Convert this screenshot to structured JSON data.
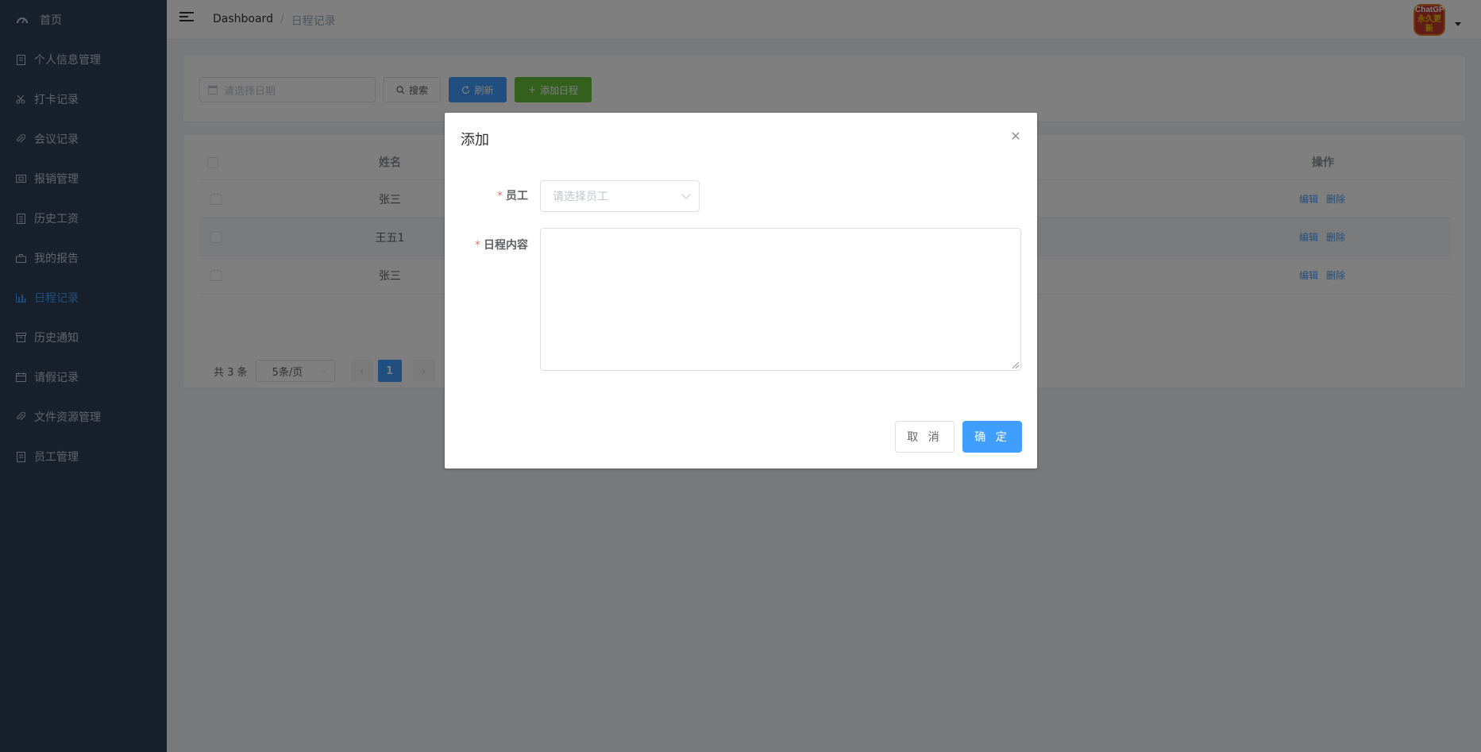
{
  "sidebar": {
    "items": [
      {
        "label": "首页",
        "icon": "dashboard-icon",
        "active": false
      },
      {
        "label": "个人信息管理",
        "icon": "document-icon",
        "active": false
      },
      {
        "label": "打卡记录",
        "icon": "scissors-icon",
        "active": false
      },
      {
        "label": "会议记录",
        "icon": "paperclip-icon",
        "active": false
      },
      {
        "label": "报销管理",
        "icon": "money-icon",
        "active": false
      },
      {
        "label": "历史工资",
        "icon": "document-icon",
        "active": false
      },
      {
        "label": "我的报告",
        "icon": "briefcase-icon",
        "active": false
      },
      {
        "label": "日程记录",
        "icon": "chart-icon",
        "active": true
      },
      {
        "label": "历史通知",
        "icon": "box-icon",
        "active": false
      },
      {
        "label": "请假记录",
        "icon": "calendar-icon",
        "active": false
      },
      {
        "label": "文件资源管理",
        "icon": "paperclip-icon",
        "active": false
      },
      {
        "label": "员工管理",
        "icon": "document-icon",
        "active": false
      }
    ]
  },
  "header": {
    "breadcrumb_home": "Dashboard",
    "breadcrumb_sep": "/",
    "breadcrumb_current": "日程记录",
    "avatar_line1": "ChatGPT",
    "avatar_line2": "永久更新"
  },
  "search": {
    "date_placeholder": "请选择日期",
    "search_label": "搜索",
    "refresh_label": "刷新",
    "add_label": "添加日程"
  },
  "table": {
    "col_name": "姓名",
    "col_ops": "操作",
    "rows": [
      {
        "name": "张三",
        "edit": "编辑",
        "delete": "删除"
      },
      {
        "name": "王五1",
        "edit": "编辑",
        "delete": "删除"
      },
      {
        "name": "张三",
        "edit": "编辑",
        "delete": "删除"
      }
    ]
  },
  "pagination": {
    "total": "共 3 条",
    "page_size": "5条/页",
    "current_page": "1"
  },
  "dialog": {
    "title": "添加",
    "employee_label": "员工",
    "employee_placeholder": "请选择员工",
    "content_label": "日程内容",
    "content_value": "",
    "cancel_label": "取 消",
    "ok_label": "确 定",
    "required_mark": "*"
  },
  "colors": {
    "primary": "#409EFF",
    "success": "#67C23A",
    "sidebar_bg": "#304156",
    "danger": "#F56C6C"
  }
}
